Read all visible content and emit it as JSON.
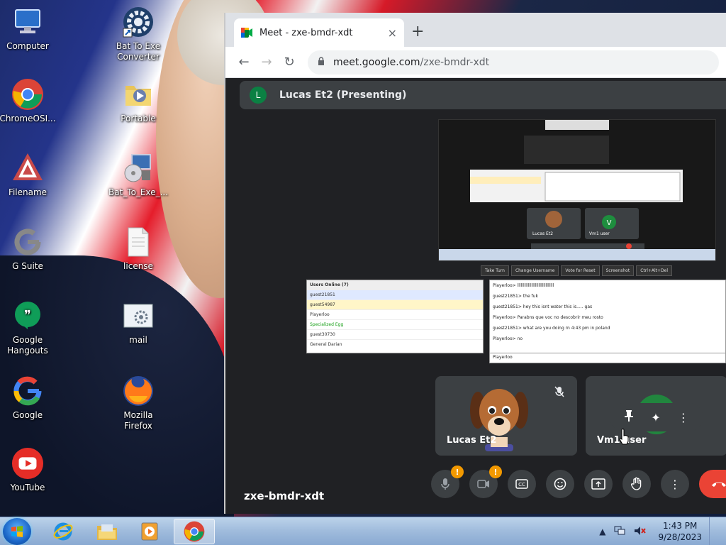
{
  "desktop": {
    "icons": [
      {
        "label": "Computer"
      },
      {
        "label": "Bat To Exe Converter"
      },
      {
        "label": "ChromeOSI..."
      },
      {
        "label": "Portable"
      },
      {
        "label": "Filename"
      },
      {
        "label": "Bat_To_Exe_..."
      },
      {
        "label": "G Suite"
      },
      {
        "label": "license"
      },
      {
        "label": "Google Hangouts"
      },
      {
        "label": "mail"
      },
      {
        "label": "Google"
      },
      {
        "label": "Mozilla Firefox"
      },
      {
        "label": "YouTube"
      }
    ]
  },
  "browser": {
    "tab_title": "Meet - zxe-bmdr-xdt",
    "tab_close": "×",
    "new_tab": "+",
    "url_host": "meet.google.com",
    "url_path": "/zxe-bmdr-xdt"
  },
  "meet": {
    "presenter_initial": "L",
    "presenter_label": "Lucas Et2 (Presenting)",
    "shared_screen": {
      "toolbar": [
        "Take Turn",
        "Change Username",
        "Vote for Reset",
        "Screenshot",
        "Ctrl+Alt+Del"
      ],
      "users_header": "Users Online (7)",
      "users": [
        "guest21851",
        "guest54987",
        "Playerloo",
        "Specialized Egg",
        "guest30730",
        "General Darian"
      ],
      "chat": [
        "Playerloo> lllllllllllllllllllllllllllllll",
        "guest21851> the fuk",
        "guest21851> hey this isnt water this is..... gas",
        "Playerloo> Parabns que voc no descobrir meu rosto",
        "guest21851> what are you doing rn 4:43 pm in poland",
        "Playerloo> no"
      ],
      "chat_user": "Playerloo",
      "inner_tiles": [
        "Lucas Et2",
        "Vm1 user"
      ],
      "inner_avatar": "V"
    },
    "tiles": [
      {
        "name": "Lucas Et2"
      },
      {
        "name": "Vm1 user"
      }
    ],
    "meeting_code": "zxe-bmdr-xdt",
    "warn_badge": "!"
  },
  "taskbar": {
    "time": "1:43 PM",
    "date": "9/28/2023"
  },
  "colors": {
    "meet_bg": "#202124",
    "tile_bg": "#3c4043",
    "hangup": "#ea4335",
    "warn": "#f29900"
  }
}
